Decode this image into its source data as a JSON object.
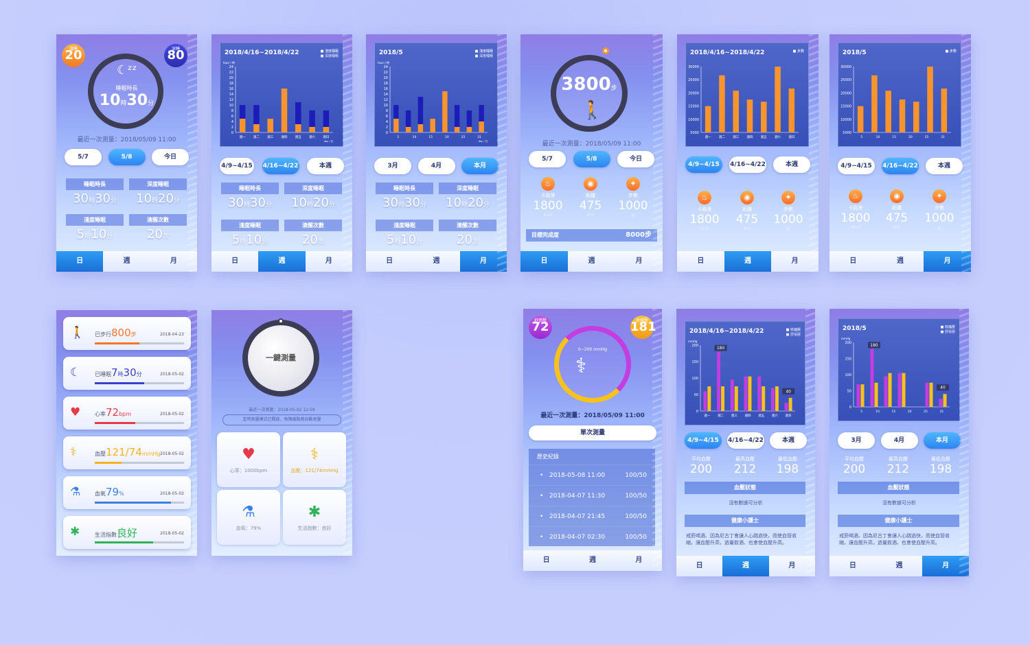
{
  "colors": {
    "accent": "#2d84f0",
    "orange": "#f7942e",
    "navy": "#1c1db8",
    "magenta": "#c33de0",
    "yellow": "#f8c21c"
  },
  "tabs": {
    "day": "日",
    "week": "週",
    "month": "月"
  },
  "s1": {
    "light_label": "淺睡",
    "light_value": "20",
    "light_unit": "%",
    "deep_label": "深睡",
    "deep_value": "80",
    "deep_unit": "%",
    "icon": "moon-zzz-icon",
    "ring_label": "睡眠時長",
    "hours": "10",
    "hours_unit": "時",
    "minutes": "30",
    "minutes_unit": "分",
    "last": "最近一次測量：2018/05/09 11:00",
    "pills": [
      "5/7",
      "5/8",
      "今日"
    ],
    "stats": [
      {
        "label": "睡眠時長",
        "h": "30",
        "m": "30"
      },
      {
        "label": "深度睡眠",
        "h": "10",
        "m": "20"
      },
      {
        "label": "淺度睡眠",
        "h": "5",
        "m": "10"
      },
      {
        "label": "清醒次數",
        "n": "20",
        "u": "次"
      }
    ]
  },
  "s2": {
    "pills": [
      "4/9~4/15",
      "4/16~4/22",
      "本週"
    ]
  },
  "s3": {
    "pills": [
      "3月",
      "4月",
      "本月"
    ]
  },
  "sleep_stats_units": {
    "h": "時",
    "m": "分"
  },
  "s4": {
    "steps": "3800",
    "steps_unit": "步",
    "last": "最近一次測量：2018/05/09 11:00",
    "pills": [
      "5/7",
      "5/8",
      "今日"
    ],
    "metrics": [
      {
        "label": "卡路里",
        "value": "1800",
        "unit": "Kcal"
      },
      {
        "label": "距離",
        "value": "475",
        "unit": "Km"
      },
      {
        "label": "步數",
        "value": "1000",
        "unit": "步"
      }
    ],
    "goal_label": "目標完成度",
    "goal_value": "8000步"
  },
  "s5": {
    "pills": [
      "4/9~4/15",
      "4/16~4/22",
      "本週"
    ]
  },
  "s6": {
    "pills": [
      "4/9~4/15",
      "4/16~4/22",
      "本週"
    ]
  },
  "health": [
    {
      "icon": "walk-icon",
      "prefix": "已步行",
      "value": "800",
      "unit": "步",
      "date": "2018-04-23",
      "color": "#f7742e",
      "fill": 0.5
    },
    {
      "icon": "sleep-icon",
      "prefix": "已睡眠",
      "value": "7",
      "mid": "時",
      "value2": "30",
      "unit": "分",
      "date": "2018-05-02",
      "color": "#3c3fc8",
      "fill": 0.55
    },
    {
      "icon": "heart-icon",
      "prefix": "心率",
      "value": "72",
      "unit": "bpm",
      "date": "2018-05-02",
      "color": "#e53a4a",
      "fill": 0.45
    },
    {
      "icon": "bp-icon",
      "prefix": "血壓",
      "value": "121/74",
      "unit": "mmHg",
      "date": "2018-05-02",
      "color": "#f5b21c",
      "fill": 0.3
    },
    {
      "icon": "oxygen-icon",
      "prefix": "血氧",
      "value": "79",
      "unit": "%",
      "date": "2018-05-02",
      "color": "#3a80e8",
      "fill": 0.85
    },
    {
      "icon": "life-icon",
      "prefix": "生活指數",
      "value": "良好",
      "unit": "",
      "date": "2018-05-02",
      "color": "#2fb35a",
      "fill": 0.65
    }
  ],
  "measure": {
    "button": "一鍵測量",
    "last": "最近一次測量：2018-05-02 12:59",
    "notice": "定時測量模式已開啟，每隔幾點將自動測量",
    "tiles": [
      {
        "icon": "heart-icon",
        "text": "心率：1000bpm"
      },
      {
        "icon": "bp-icon",
        "text": "血壓：121/74mmHg"
      },
      {
        "icon": "oxygen-icon",
        "text": "血氧：79%"
      },
      {
        "icon": "life-icon",
        "text": "生活指數：良好"
      }
    ]
  },
  "bp": {
    "diastolic_label": "舒張壓",
    "diastolic": "72",
    "systolic_label": "收縮壓",
    "systolic": "181",
    "range": "0~200 mmHg",
    "last": "最近一次測量：2018/05/09 11:00",
    "single": "單次測量",
    "history_title": "歷史紀錄",
    "history": [
      {
        "time": "2018-05-08 11:00",
        "val": "100/50"
      },
      {
        "time": "2018-04-07 11:30",
        "val": "100/50"
      },
      {
        "time": "2018-04-07 21:45",
        "val": "100/50"
      },
      {
        "time": "2018-04-07 02:30",
        "val": "100/50"
      }
    ]
  },
  "bpw": {
    "pills": [
      "4/9~4/15",
      "4/16~4/22",
      "本週"
    ]
  },
  "bpm": {
    "pills": [
      "3月",
      "4月",
      "本月"
    ]
  },
  "bp_stats": [
    {
      "label": "平均血壓",
      "value": "200"
    },
    {
      "label": "最高血壓",
      "value": "212"
    },
    {
      "label": "最低血壓",
      "value": "198"
    }
  ],
  "bp_state_label": "血壓狀態",
  "bp_state_text": "沒有數據可分析",
  "tips_label": "健康小護士",
  "tips_text": "戒菸喝酒、因為尼古丁會讓人心跳過快，而使血管收縮，讓血壓升高，過量飲酒、也會使血壓升高。",
  "chart_data": [
    {
      "type": "bar",
      "title": "2018/4/16~2018/4/22",
      "legend": [
        "淺度睡眠",
        "深度睡眠"
      ],
      "ylabel": "hour / 時",
      "ylim": [
        0,
        24
      ],
      "yticks": [
        0,
        2,
        4,
        6,
        8,
        10,
        12,
        14,
        16,
        18,
        20,
        22,
        24
      ],
      "categories": [
        "週一",
        "週二",
        "週三",
        "週四",
        "週五",
        "週六",
        "週日"
      ],
      "xlabel": "day / 日",
      "series": [
        {
          "name": "淺度睡眠",
          "values": [
            5,
            3,
            5,
            16,
            3,
            2,
            2
          ]
        },
        {
          "name": "深度睡眠",
          "values": [
            5,
            7,
            0,
            0,
            8,
            6,
            6
          ]
        }
      ]
    },
    {
      "type": "bar",
      "title": "2018/5",
      "legend": [
        "淺度睡眠",
        "深度睡眠"
      ],
      "ylabel": "hour / 時",
      "ylim": [
        0,
        24
      ],
      "yticks": [
        0,
        2,
        4,
        6,
        8,
        10,
        12,
        14,
        16,
        18,
        20,
        22,
        24
      ],
      "categories": [
        "5",
        "10",
        "15",
        "20",
        "25",
        "31"
      ],
      "xlabel": "day / 日",
      "series": [
        {
          "name": "淺度睡眠",
          "values": [
            5,
            2,
            3,
            5,
            15,
            2,
            2,
            4
          ]
        },
        {
          "name": "深度睡眠",
          "values": [
            5,
            6,
            10,
            0,
            0,
            8,
            6,
            6
          ]
        }
      ]
    },
    {
      "type": "bar",
      "title": "2018/4/16~2018/4/22",
      "legend": [
        "步數"
      ],
      "ylim": [
        0,
        30000
      ],
      "yticks": [
        "5000",
        "10000",
        "15000",
        "20000",
        "25000",
        "30000"
      ],
      "categories": [
        "週一",
        "週二",
        "週三",
        "週四",
        "週五",
        "週六",
        "週日"
      ],
      "series": [
        {
          "name": "步數",
          "values": [
            12000,
            26000,
            19000,
            15000,
            14000,
            30000,
            20000
          ]
        }
      ]
    },
    {
      "type": "bar",
      "title": "2018/5",
      "legend": [
        "步數"
      ],
      "ylim": [
        0,
        30000
      ],
      "yticks": [
        "5000",
        "10000",
        "15000",
        "20000",
        "25000",
        "30000"
      ],
      "categories": [
        "5",
        "10",
        "15",
        "20",
        "25",
        "31"
      ],
      "series": [
        {
          "name": "步數",
          "values": [
            12000,
            26000,
            19000,
            15000,
            14000,
            30000,
            20000
          ]
        }
      ]
    },
    {
      "type": "bar",
      "title": "2018/4/16~2018/4/22",
      "legend": [
        "收縮壓",
        "舒張壓"
      ],
      "ylabel": "mmHg",
      "ylim": [
        0,
        200
      ],
      "yticks": [
        0,
        50,
        100,
        150,
        200
      ],
      "categories": [
        "週一",
        "週二",
        "週三",
        "週四",
        "週五",
        "週六",
        "週日"
      ],
      "series": [
        {
          "name": "收縮壓",
          "values": [
            60,
            180,
            95,
            105,
            105,
            70,
            25
          ]
        },
        {
          "name": "舒張壓",
          "values": [
            75,
            75,
            75,
            105,
            75,
            75,
            40
          ]
        }
      ],
      "annotations": [
        "180",
        "40"
      ]
    },
    {
      "type": "bar",
      "title": "2018/5",
      "legend": [
        "收縮壓",
        "舒張壓"
      ],
      "ylabel": "mmHg",
      "ylim": [
        0,
        200
      ],
      "yticks": [
        0,
        50,
        100,
        150,
        200
      ],
      "categories": [
        "5",
        "10",
        "15",
        "20",
        "25",
        "31"
      ],
      "series": [
        {
          "name": "收縮壓",
          "values": [
            70,
            180,
            95,
            105,
            0,
            75,
            25
          ]
        },
        {
          "name": "舒張壓",
          "values": [
            70,
            75,
            105,
            105,
            0,
            75,
            40
          ]
        }
      ],
      "annotations": [
        "180",
        "40"
      ]
    }
  ]
}
